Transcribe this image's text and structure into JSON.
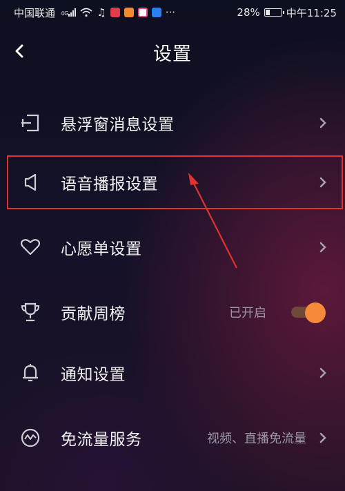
{
  "status_bar": {
    "carrier": "中国联通",
    "network_tag": "4G",
    "battery": "28%",
    "battery_level": 0.28,
    "time": "中午11:25",
    "more": "···"
  },
  "header": {
    "title": "设置",
    "back_icon": "chevron-left-icon"
  },
  "settings": [
    {
      "id": "floating-window",
      "icon": "exit-door-icon",
      "label": "悬浮窗消息设置",
      "value": "",
      "control": "chevron"
    },
    {
      "id": "voice-broadcast",
      "icon": "speaker-icon",
      "label": "语音播报设置",
      "value": "",
      "control": "chevron",
      "highlighted": true
    },
    {
      "id": "wishlist",
      "icon": "heart-icon",
      "label": "心愿单设置",
      "value": "",
      "control": "chevron"
    },
    {
      "id": "contribution-rank",
      "icon": "trophy-icon",
      "label": "贡献周榜",
      "value": "已开启",
      "control": "toggle",
      "toggle_on": true
    },
    {
      "id": "notifications",
      "icon": "bell-icon",
      "label": "通知设置",
      "value": "",
      "control": "chevron"
    },
    {
      "id": "free-data",
      "icon": "wave-circle-icon",
      "label": "免流量服务",
      "value": "视频、直播免流量",
      "control": "chevron"
    }
  ],
  "colors": {
    "highlight_border": "#e0322e",
    "toggle_knob": "#f58a3a",
    "toggle_track": "#6e4a3a",
    "secondary_text": "#9a98a6"
  }
}
